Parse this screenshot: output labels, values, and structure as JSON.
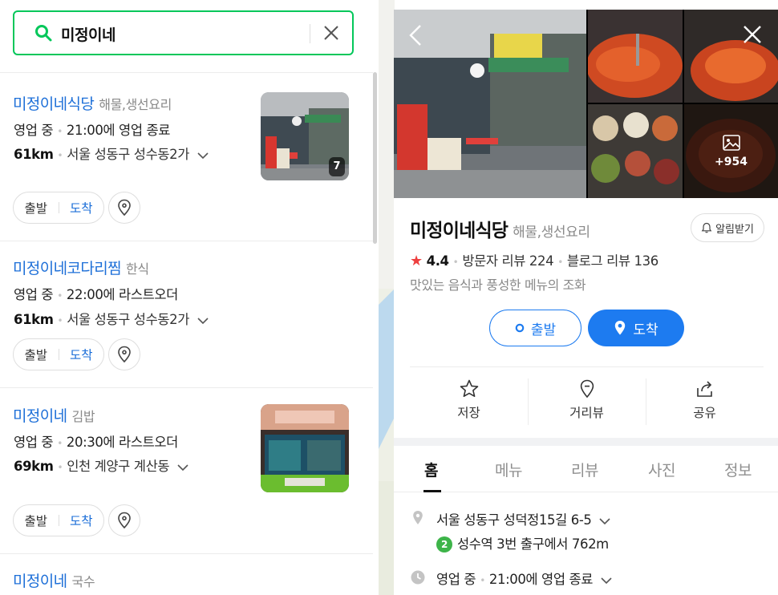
{
  "search": {
    "query": "미정이네"
  },
  "results": [
    {
      "name": "미정이네식당",
      "category": "해물,생선요리",
      "status_label": "영업 중",
      "status_detail": "21:00에 영업 종료",
      "distance": "61km",
      "address": "서울 성동구 성수동2가",
      "photo_count": "7",
      "depart_label": "출발",
      "arrive_label": "도착"
    },
    {
      "name": "미정이네코다리찜",
      "category": "한식",
      "status_label": "영업 중",
      "status_detail": "22:00에 라스트오더",
      "distance": "61km",
      "address": "서울 성동구 성수동2가",
      "depart_label": "출발",
      "arrive_label": "도착"
    },
    {
      "name": "미정이네",
      "category": "김밥",
      "status_label": "영업 중",
      "status_detail": "20:30에 라스트오더",
      "distance": "69km",
      "address": "인천 계양구 계산동",
      "depart_label": "출발",
      "arrive_label": "도착"
    },
    {
      "name": "미정이네",
      "category": "국수"
    }
  ],
  "detail": {
    "name": "미정이네식당",
    "category": "해물,생선요리",
    "alarm_label": "알림받기",
    "rating": "4.4",
    "visitor_reviews": "방문자 리뷰 224",
    "blog_reviews": "블로그 리뷰 136",
    "description": "맛있는 음식과 풍성한 메뉴의 조화",
    "more_photos": "+954",
    "depart_label": "출발",
    "arrive_label": "도착",
    "actions": [
      "저장",
      "거리뷰",
      "공유"
    ],
    "tabs": [
      "홈",
      "메뉴",
      "리뷰",
      "사진",
      "정보"
    ],
    "active_tab": "홈",
    "address": "서울 성동구 성덕정15길 6-5",
    "subway_line": "2",
    "subway_directions": "성수역 3번 출구에서 762m",
    "status_label": "영업 중",
    "status_detail": "21:00에 영업 종료"
  },
  "colors": {
    "accent_green": "#03c75a",
    "link_blue": "#1d6fd8",
    "button_blue": "#1d7bf0",
    "star_red": "#ee3f3f",
    "subway_line2": "#3db449"
  }
}
